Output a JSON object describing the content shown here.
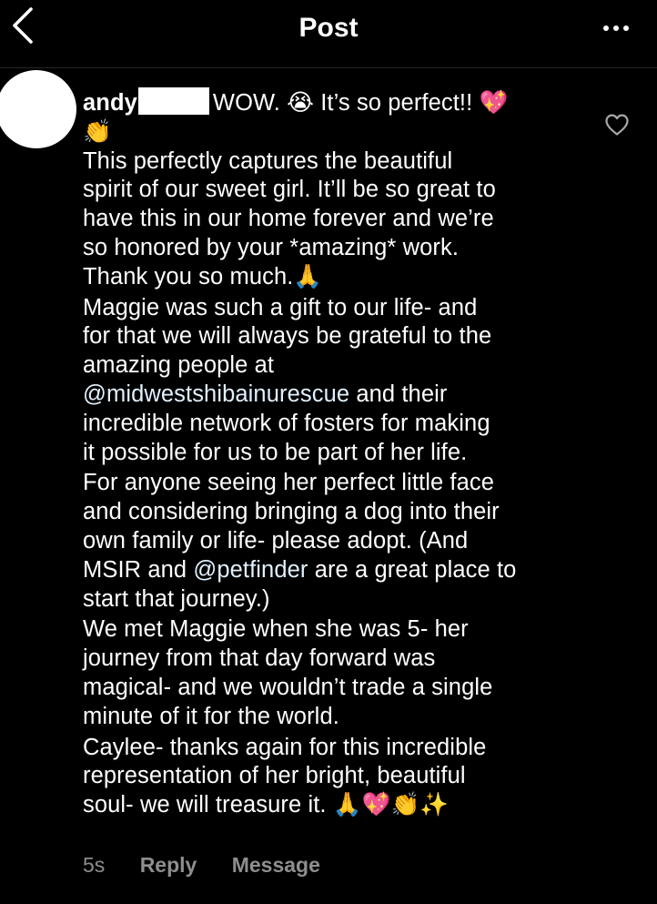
{
  "header": {
    "title": "Post",
    "back_icon": "chevron-left-icon",
    "more_icon": "more-horizontal-icon"
  },
  "comment": {
    "username": "andy",
    "first_line": "WOW. 😭 It’s so perfect!! 💖",
    "first_line_wrap": "👏",
    "paragraphs": [
      "This perfectly captures the beautiful\nspirit of our sweet girl. It’ll be so great to\nhave this in our home forever and we’re\nso honored by your *amazing* work.\nThank you so much.🙏",
      "Maggie was such a gift to our life- and\nfor that we will always be grateful to the\namazing people at",
      "and their\nincredible network of fosters for making\nit possible for us to be part of her life.",
      "For anyone seeing her perfect little face\nand considering bringing a dog into their\nown family or life- please adopt. (And\nMSIR and",
      "are a great place to\nstart that journey.)",
      "We met Maggie when she was 5- her\njourney from that day forward was\nmagical- and we wouldn’t trade a single\nminute of it for the world.",
      "Caylee- thanks again for this incredible\nrepresentation of her bright, beautiful\nsoul- we will treasure it. 🙏💖👏✨"
    ],
    "mentions": {
      "rescue": "@midwestshibainurescue",
      "petfinder": "@petfinder"
    },
    "like_icon": "heart-outline-icon"
  },
  "actions": {
    "time": "5s",
    "reply_label": "Reply",
    "message_label": "Message"
  },
  "colors": {
    "background": "#000000",
    "text": "#ffffff",
    "mention": "#e0f1ff",
    "secondary": "#8e8e8e"
  }
}
